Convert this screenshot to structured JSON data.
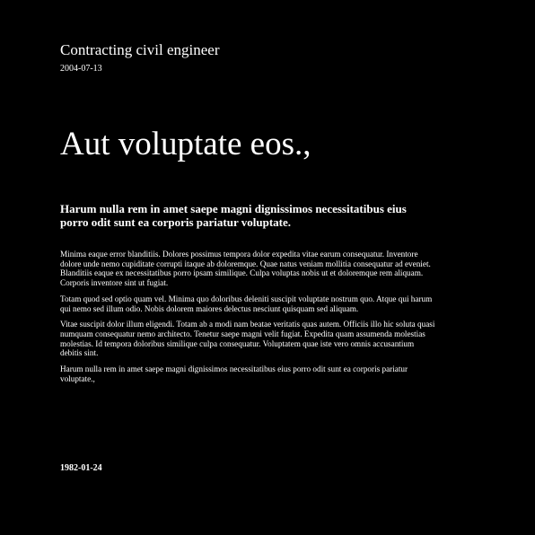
{
  "header": {
    "title": "Contracting civil engineer",
    "date": "2004-07-13"
  },
  "main": {
    "title": "Aut voluptate eos.,",
    "subtitle": "Harum nulla rem in amet saepe magni dignissimos necessitatibus eius porro odit sunt ea corporis pariatur voluptate.",
    "paragraphs": [
      "Minima eaque error blanditiis. Dolores possimus tempora dolor expedita vitae earum consequatur. Inventore dolore unde nemo cupiditate corrupti itaque ab doloremque. Quae natus veniam mollitia consequatur ad eveniet. Blanditiis eaque ex necessitatibus porro ipsam similique. Culpa voluptas nobis ut et doloremque rem aliquam. Corporis inventore sint ut fugiat.",
      "Totam quod sed optio quam vel. Minima quo doloribus deleniti suscipit voluptate nostrum quo. Atque qui harum qui nemo sed illum odio. Nobis dolorem maiores delectus nesciunt quisquam sed aliquam.",
      "Vitae suscipit dolor illum eligendi. Totam ab a modi nam beatae veritatis quas autem. Officiis illo hic soluta quasi numquam consequatur nemo architecto. Tenetur saepe magni velit fugiat. Expedita quam assumenda molestias molestias. Id tempora doloribus similique culpa consequatur. Voluptatem quae iste vero omnis accusantium debitis sint.",
      "Harum nulla rem in amet saepe magni dignissimos necessitatibus eius porro odit sunt ea corporis pariatur voluptate.,"
    ]
  },
  "footer": {
    "date": "1982-01-24"
  },
  "colors": {
    "background": "#000000",
    "text": "#ffffff"
  }
}
